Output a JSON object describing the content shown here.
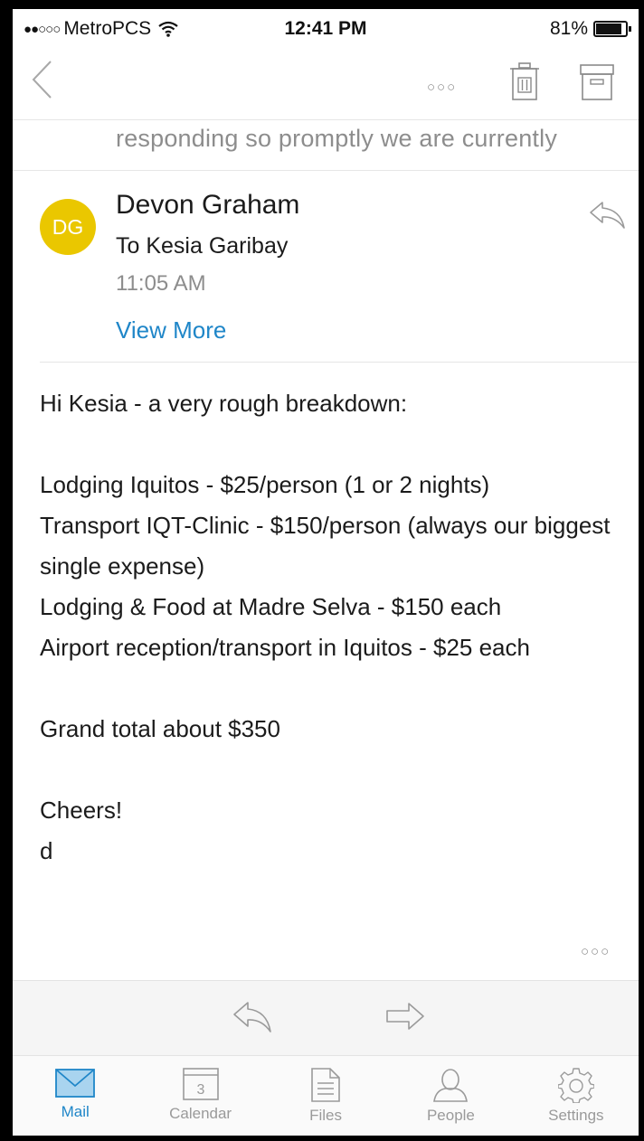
{
  "status_bar": {
    "carrier": "MetroPCS",
    "time": "12:41 PM",
    "battery": "81%",
    "battery_level": 0.81
  },
  "toolbar": {
    "more_label": "○○○"
  },
  "previous_snippet": "responding so promptly we are currently",
  "message": {
    "avatar_initials": "DG",
    "avatar_color": "#eac700",
    "sender": "Devon Graham",
    "to": "To Kesia Garibay",
    "time": "11:05 AM",
    "view_more": "View More",
    "body": {
      "greeting": "Hi Kesia - a very rough breakdown:",
      "line1": "Lodging Iquitos - $25/person (1 or 2 nights)",
      "line2": "Transport IQT-Clinic - $150/person (always our biggest single expense)",
      "line3": "Lodging & Food at Madre Selva - $150 each",
      "line4": "Airport reception/transport in Iquitos - $25 each",
      "total": "Grand total about $350",
      "signoff": "Cheers!",
      "signature": "d"
    },
    "more_label": "○○○"
  },
  "tabs": [
    {
      "label": "Mail",
      "icon": "mail-icon",
      "active": true
    },
    {
      "label": "Calendar",
      "icon": "calendar-icon",
      "badge": "3"
    },
    {
      "label": "Files",
      "icon": "files-icon"
    },
    {
      "label": "People",
      "icon": "people-icon"
    },
    {
      "label": "Settings",
      "icon": "settings-icon"
    }
  ],
  "colors": {
    "accent": "#1f86c8",
    "muted": "#8d8d8d"
  }
}
